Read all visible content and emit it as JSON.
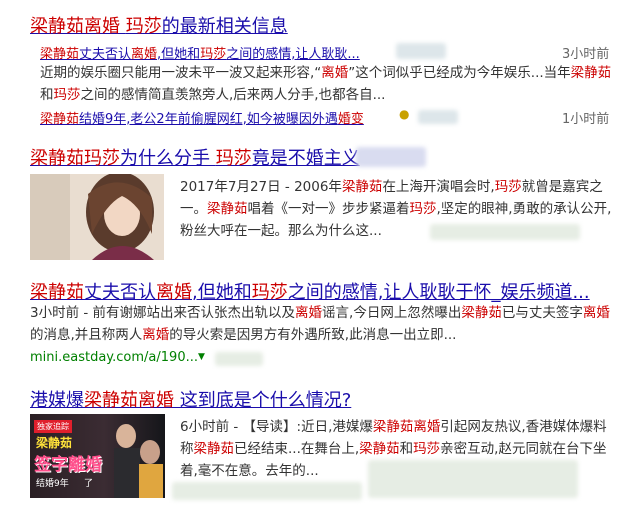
{
  "results": [
    {
      "title_parts": [
        {
          "text": "梁静茹离婚",
          "hl": true
        },
        {
          "text": " ",
          "hl": false
        },
        {
          "text": "玛莎",
          "hl": true
        },
        {
          "text": "的最新相关信息",
          "hl": false
        }
      ],
      "subs": [
        {
          "parts": [
            {
              "text": "梁静茹",
              "hl": true
            },
            {
              "text": "丈夫否认",
              "hl": false
            },
            {
              "text": "离婚",
              "hl": true
            },
            {
              "text": ",但她和",
              "hl": false
            },
            {
              "text": "玛莎",
              "hl": true
            },
            {
              "text": "之间的感情,让人耿耿...",
              "hl": false
            }
          ],
          "time": "3小时前",
          "snippet_parts": [
            {
              "text": "近期的娱乐圈只能用一波未平一波又起来形容,“",
              "hl": false
            },
            {
              "text": "离婚",
              "hl": true
            },
            {
              "text": "”这个词似乎已经成为今年娱乐...当年",
              "hl": false
            },
            {
              "text": "梁静茹",
              "hl": true
            },
            {
              "text": "和",
              "hl": false
            },
            {
              "text": "玛莎",
              "hl": true
            },
            {
              "text": "之间的感情简直羡煞旁人,后来两人分手,也都各自...",
              "hl": false
            }
          ]
        },
        {
          "parts": [
            {
              "text": "梁静茹",
              "hl": true
            },
            {
              "text": "结婚9年,老公2年前偷腥网红,如今被曝因外遇",
              "hl": false
            },
            {
              "text": "婚变",
              "hl": true
            }
          ],
          "time": "1小时前"
        }
      ]
    },
    {
      "title_parts": [
        {
          "text": "梁静茹",
          "hl": true
        },
        {
          "text": "玛莎",
          "hl": true
        },
        {
          "text": "为什么分手 ",
          "hl": false
        },
        {
          "text": "玛莎",
          "hl": true
        },
        {
          "text": "竟是不婚主义",
          "hl": false
        }
      ],
      "snippet_parts": [
        {
          "text": "2017年7月27日 - 2006年",
          "hl": false
        },
        {
          "text": "梁静茹",
          "hl": true
        },
        {
          "text": "在上海开演唱会时,",
          "hl": false
        },
        {
          "text": "玛莎",
          "hl": true
        },
        {
          "text": "就曾是嘉宾之一。",
          "hl": false
        },
        {
          "text": "梁静茹",
          "hl": true
        },
        {
          "text": "唱着《一对一》步步紧逼着",
          "hl": false
        },
        {
          "text": "玛莎",
          "hl": true
        },
        {
          "text": ",坚定的眼神,勇敢的承认公开,粉丝大呼在一起。那么为什么这...",
          "hl": false
        }
      ]
    },
    {
      "title_parts": [
        {
          "text": "梁静茹",
          "hl": true
        },
        {
          "text": "丈夫否认",
          "hl": false
        },
        {
          "text": "离婚",
          "hl": true
        },
        {
          "text": ",但她和",
          "hl": false
        },
        {
          "text": "玛莎",
          "hl": true
        },
        {
          "text": "之间的感情,让人耿耿于怀_娱乐频道...",
          "hl": false
        }
      ],
      "snippet_parts": [
        {
          "text": "3小时前 - 前有谢娜站出来否认张杰出轨以及",
          "hl": false
        },
        {
          "text": "离婚",
          "hl": true
        },
        {
          "text": "谣言,今日网上忽然曝出",
          "hl": false
        },
        {
          "text": "梁静茹",
          "hl": true
        },
        {
          "text": "已与丈夫签字",
          "hl": false
        },
        {
          "text": "离婚",
          "hl": true
        },
        {
          "text": "的消息,并且称两人",
          "hl": false
        },
        {
          "text": "离婚",
          "hl": true
        },
        {
          "text": "的导火索是因男方有外遇所致,此消息一出立即...",
          "hl": false
        }
      ],
      "url": "mini.eastday.com/a/190..."
    },
    {
      "title_parts": [
        {
          "text": "港媒爆",
          "hl": false
        },
        {
          "text": "梁静茹离婚",
          "hl": true
        },
        {
          "text": " 这到底是个什么情况?",
          "hl": false
        }
      ],
      "snippet_parts": [
        {
          "text": "6小时前 - 【导读】:近日,港媒爆",
          "hl": false
        },
        {
          "text": "梁静茹离婚",
          "hl": true
        },
        {
          "text": "引起网友热议,香港媒体爆料称",
          "hl": false
        },
        {
          "text": "梁静茹",
          "hl": true
        },
        {
          "text": "已经结束...在舞台上,",
          "hl": false
        },
        {
          "text": "梁静茹",
          "hl": true
        },
        {
          "text": "和",
          "hl": false
        },
        {
          "text": "玛莎",
          "hl": true
        },
        {
          "text": "亲密互动,赵元同就在台下坐着,毫不在意。去年的...",
          "hl": false
        }
      ],
      "thumb_text": {
        "top": "独家追踪",
        "l1": "梁静茹",
        "l2": "签字離婚",
        "l3": "结婚9年",
        "tag": "了"
      }
    }
  ],
  "colors": {
    "link": "#1a0dab",
    "highlight": "#cc0000",
    "url": "#008000"
  }
}
